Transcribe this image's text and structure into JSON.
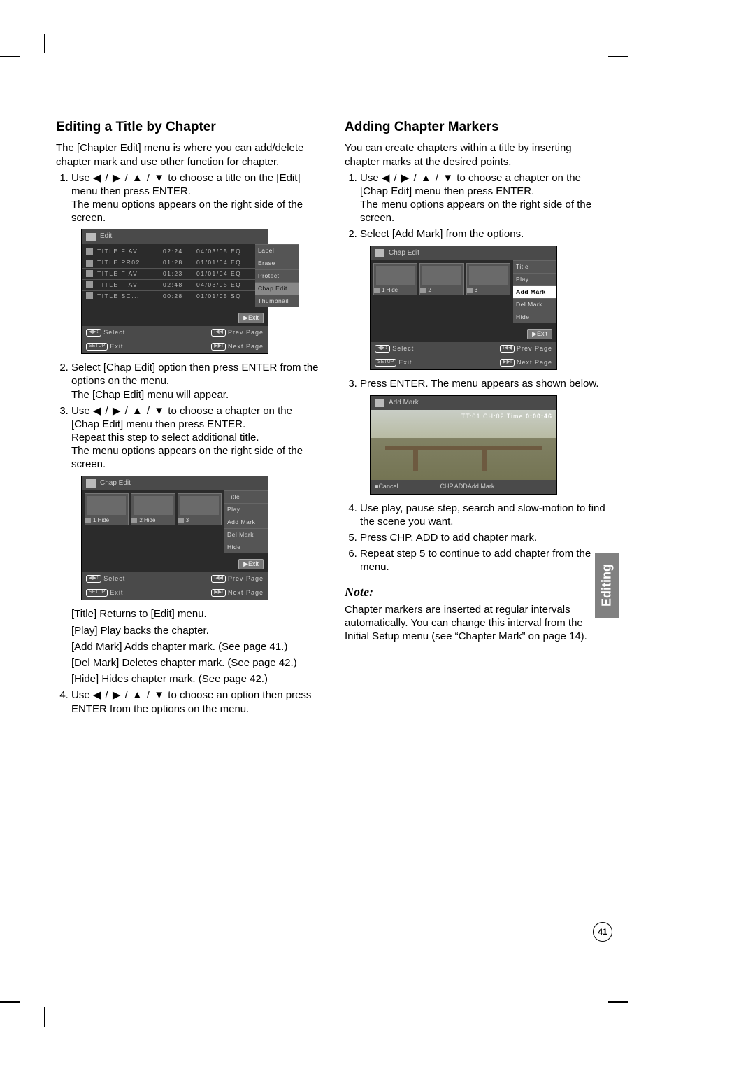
{
  "sideTab": "Editing",
  "pageNumber": "41",
  "arrowGlyphs": "◀ / ▶ / ▲ / ▼",
  "left": {
    "heading": "Editing a Title by Chapter",
    "intro": "The [Chapter Edit] menu is where you can add/delete chapter mark and use other function for chapter.",
    "step1_a": "Use ",
    "step1_b": " to choose a title on the [Edit] menu then press ENTER.",
    "step1_c": "The menu options appears on the right side of the screen.",
    "step2_a": "Select [Chap Edit] option then press ENTER from the options on the menu.",
    "step2_b": "The [Chap Edit] menu will appear.",
    "step3_a": "Use ",
    "step3_b": " to choose a chapter on the [Chap Edit] menu then press ENTER.",
    "step3_c": "Repeat this step to select additional title.",
    "step3_d": "The menu options appears on the right side of the screen.",
    "desc_title": "[Title] Returns to [Edit] menu.",
    "desc_play": "[Play] Play backs the chapter.",
    "desc_add": "[Add Mark] Adds chapter mark. (See page 41.)",
    "desc_del": "[Del Mark] Deletes chapter mark. (See page 42.)",
    "desc_hide": "[Hide] Hides chapter mark. (See page 42.)",
    "step4_a": "Use ",
    "step4_b": " to choose an option then press ENTER from the options on the menu."
  },
  "right": {
    "heading": "Adding Chapter Markers",
    "intro": "You can create chapters within a title by inserting chapter marks at the desired points.",
    "step1_a": "Use ",
    "step1_b": " to choose a chapter on the [Chap Edit] menu then press ENTER.",
    "step1_c": "The menu options appears on the right side of the screen.",
    "step2": "Select [Add Mark] from the options.",
    "step3": "Press ENTER. The menu appears as shown below.",
    "step4": "Use play, pause step, search and slow-motion to find the scene you want.",
    "step5": "Press CHP. ADD to add chapter mark.",
    "step6": "Repeat step 5 to continue to add chapter from the menu.",
    "noteHead": "Note:",
    "noteBody": "Chapter markers are inserted at regular intervals automatically. You can change this interval from the Initial Setup menu (see “Chapter Mark” on page 14)."
  },
  "editShot": {
    "title": "Edit",
    "rows": [
      {
        "name": "TITLE F AV",
        "dur": "02:24",
        "date": "04/03/05 EQ"
      },
      {
        "name": "TITLE PR02",
        "dur": "01:28",
        "date": "01/01/04 EQ"
      },
      {
        "name": "TITLE F AV",
        "dur": "01:23",
        "date": "01/01/04 EQ"
      },
      {
        "name": "TITLE F AV",
        "dur": "02:48",
        "date": "04/03/05 EQ"
      },
      {
        "name": "TITLE SC...",
        "dur": "00:28",
        "date": "01/01/05 SQ"
      }
    ],
    "side": [
      "Label",
      "Erase",
      "Protect",
      "Chap Edit",
      "Thumbnail"
    ],
    "exit": "▶Exit",
    "footer": {
      "select": "Select",
      "exit": "Exit",
      "prev": "Prev Page",
      "next": "Next Page",
      "k1": "◀▶↕",
      "k2": "SETUP",
      "k3": "I◀◀",
      "k4": "▶▶I"
    }
  },
  "chapShot": {
    "title": "Chap Edit",
    "slots": [
      {
        "n": "1",
        "h": "Hide"
      },
      {
        "n": "2",
        "h": "Hide"
      },
      {
        "n": "3",
        "h": ""
      }
    ],
    "side": [
      "Title",
      "Play",
      "Add Mark",
      "Del Mark",
      "Hide"
    ],
    "sideGray": [
      3,
      4
    ],
    "exit": "▶Exit",
    "footer": {
      "select": "Select",
      "exit": "Exit",
      "prev": "Prev Page",
      "next": "Next Page",
      "k1": "◀▶↕",
      "k2": "SETUP",
      "k3": "I◀◀",
      "k4": "▶▶I"
    }
  },
  "chapShot2": {
    "title": "Chap Edit",
    "slots": [
      {
        "n": "1",
        "h": "Hide"
      },
      {
        "n": "2",
        "h": ""
      },
      {
        "n": "3",
        "h": ""
      }
    ],
    "side": [
      "Title",
      "Play",
      "Add Mark",
      "Del Mark",
      "Hide"
    ],
    "selIndex": 2,
    "exit": "▶Exit",
    "footer": {
      "select": "Select",
      "exit": "Exit",
      "prev": "Prev Page",
      "next": "Next Page",
      "k1": "◀▶↕",
      "k2": "SETUP",
      "k3": "I◀◀",
      "k4": "▶▶I"
    }
  },
  "markShot": {
    "title": "Add Mark",
    "osd_pre": "TT:01 CH:02 Time ",
    "osd_time": "0:00:46",
    "cancelKey": "■",
    "cancel": "Cancel",
    "addKey": "CHP.ADD",
    "add": "Add Mark"
  }
}
